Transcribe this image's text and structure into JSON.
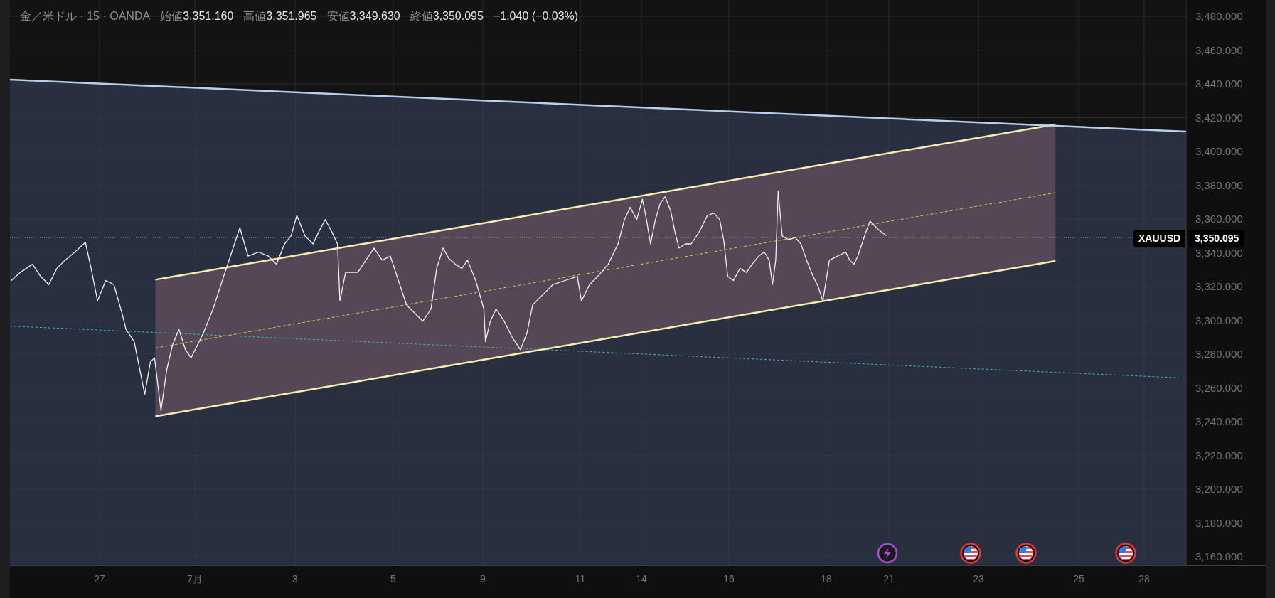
{
  "header": {
    "symbol": "金／米ドル · 15 · OANDA",
    "ohlc": [
      {
        "label": "始値",
        "value": "3,351.160"
      },
      {
        "label": "高値",
        "value": "3,351.965"
      },
      {
        "label": "安値",
        "value": "3,349.630"
      },
      {
        "label": "終値",
        "value": "3,350.095"
      }
    ],
    "change": "−1.040 (−0.03%)"
  },
  "price_axis": {
    "labels": [
      "3,480.000",
      "3,460.000",
      "3,440.000",
      "3,420.000",
      "3,400.000",
      "3,380.000",
      "3,360.000",
      "3,340.000",
      "3,320.000",
      "3,300.000",
      "3,280.000",
      "3,260.000",
      "3,240.000",
      "3,220.000",
      "3,200.000",
      "3,180.000",
      "3,160.000"
    ],
    "current": {
      "symbol": "XAUUSD",
      "price": "3,350.095"
    }
  },
  "time_axis": {
    "labels": [
      "27",
      "7月",
      "3",
      "5",
      "9",
      "11",
      "14",
      "16",
      "18",
      "21",
      "23",
      "25",
      "28"
    ]
  },
  "events": [
    {
      "kind": "lightning"
    },
    {
      "kind": "us-flag"
    },
    {
      "kind": "us-flag"
    },
    {
      "kind": "us-flag"
    }
  ]
}
